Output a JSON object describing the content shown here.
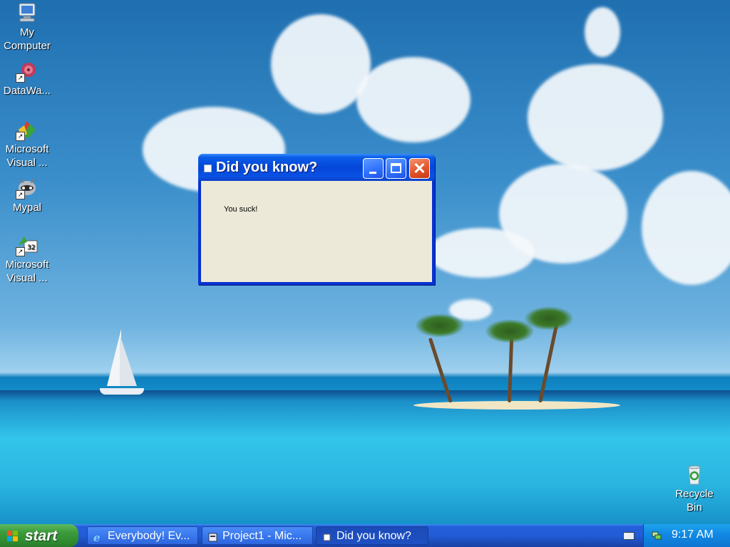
{
  "desktop": {
    "icons": [
      {
        "label": "My Computer",
        "icon": "computer-icon"
      },
      {
        "label": "DataWa...",
        "icon": "datawarehouse-shortcut-icon"
      },
      {
        "label": "Microsoft Visual ...",
        "icon": "visual-studio-shortcut-icon"
      },
      {
        "label": "Mypal",
        "icon": "mypal-shortcut-icon"
      },
      {
        "label": "Microsoft Visual ...",
        "icon": "visual-basic-shortcut-icon"
      },
      {
        "label": "Recycle Bin",
        "icon": "recycle-bin-icon"
      }
    ]
  },
  "dialog": {
    "title": "Did you know?",
    "message": "You suck!",
    "buttons": {
      "minimize": "minimize-icon",
      "maximize": "maximize-icon",
      "close": "close-icon"
    }
  },
  "taskbar": {
    "start_label": "start",
    "tasks": [
      {
        "label": "Everybody! Ev...",
        "icon": "internet-explorer-icon",
        "active": false
      },
      {
        "label": "Project1 - Mic...",
        "icon": "visual-basic-icon",
        "active": false
      },
      {
        "label": "Did you know?",
        "icon": "window-icon",
        "active": true
      }
    ],
    "clock": "9:17 AM"
  },
  "colors": {
    "titlebar": "#0446d8",
    "start_button": "#3c9b3c",
    "taskbar": "#225cd6",
    "dialog_client": "#ece9d8"
  }
}
